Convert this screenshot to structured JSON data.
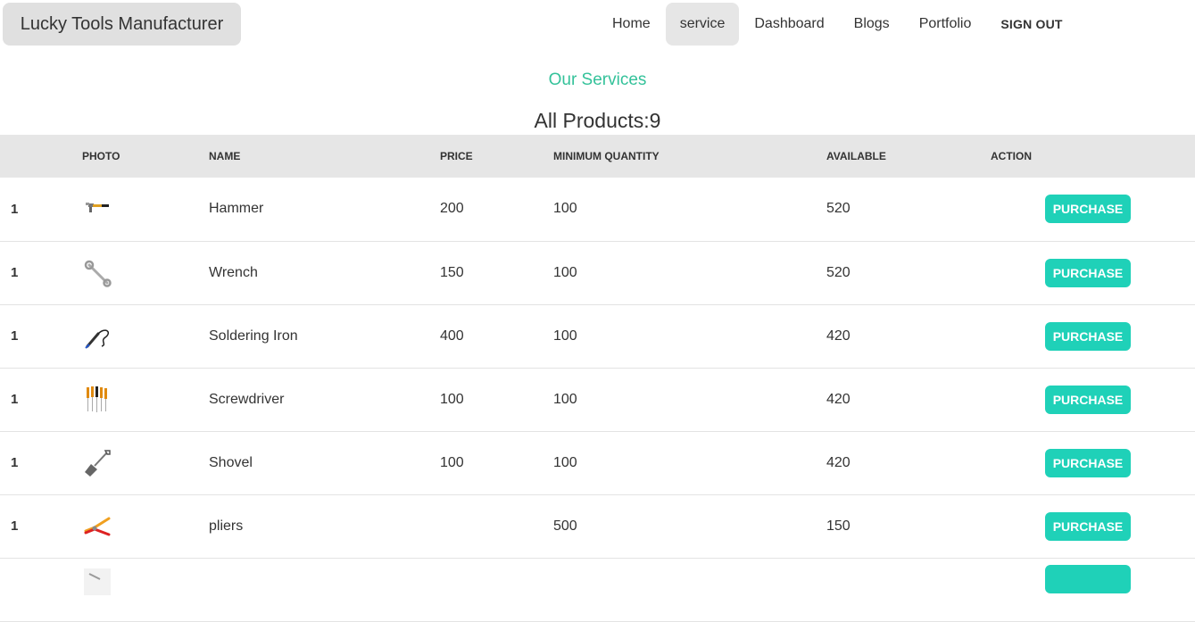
{
  "navbar": {
    "brand": "Lucky Tools Manufacturer",
    "items": [
      {
        "label": "Home",
        "active": false
      },
      {
        "label": "service",
        "active": true
      },
      {
        "label": "Dashboard",
        "active": false
      },
      {
        "label": "Blogs",
        "active": false
      },
      {
        "label": "Portfolio",
        "active": false
      }
    ],
    "signout": "SIGN OUT"
  },
  "section_title": "Our Services",
  "products_title": "All Products:9",
  "table": {
    "headers": [
      "PHOTO",
      "NAME",
      "PRICE",
      "MINIMUM QUANTITY",
      "AVAILABLE",
      "ACTION"
    ],
    "rows": [
      {
        "index": "1",
        "icon": "hammer-icon",
        "name": "Hammer",
        "price": "200",
        "min_qty": "100",
        "available": "520",
        "action": "PURCHASE"
      },
      {
        "index": "1",
        "icon": "wrench-icon",
        "name": "Wrench",
        "price": "150",
        "min_qty": "100",
        "available": "520",
        "action": "PURCHASE"
      },
      {
        "index": "1",
        "icon": "soldering-iron-icon",
        "name": "Soldering Iron",
        "price": "400",
        "min_qty": "100",
        "available": "420",
        "action": "PURCHASE"
      },
      {
        "index": "1",
        "icon": "screwdriver-icon",
        "name": "Screwdriver",
        "price": "100",
        "min_qty": "100",
        "available": "420",
        "action": "PURCHASE"
      },
      {
        "index": "1",
        "icon": "shovel-icon",
        "name": "Shovel",
        "price": "100",
        "min_qty": "100",
        "available": "420",
        "action": "PURCHASE"
      },
      {
        "index": "1",
        "icon": "pliers-icon",
        "name": "pliers",
        "price": "",
        "min_qty": "500",
        "available": "150",
        "action": "PURCHASE"
      },
      {
        "index": "",
        "icon": "tool-icon",
        "name": "",
        "price": "",
        "min_qty": "",
        "available": "",
        "action": ""
      }
    ]
  },
  "colors": {
    "accent": "#34c29a",
    "button": "#1fd1b8",
    "header_bg": "#e6e6e6"
  }
}
